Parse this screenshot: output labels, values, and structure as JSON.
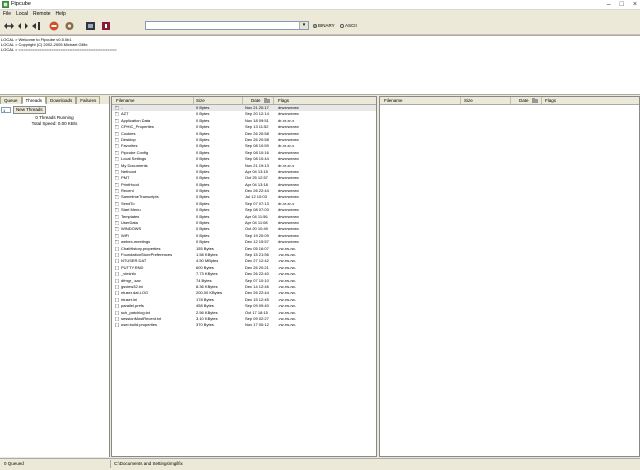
{
  "window": {
    "title": "Ftpcube"
  },
  "menu": [
    "File",
    "Local",
    "Remote",
    "Help"
  ],
  "toolbar": {
    "transfer_mode": {
      "binary": "BINARY",
      "ascii": "ASCII",
      "selected": "binary"
    },
    "icons": [
      "connect-icon",
      "disconnect-icon",
      "abort-icon",
      "stop-icon",
      "options-icon",
      "bookmarks-icon"
    ]
  },
  "log": [
    "LOCAL > Welcome to Ftpcube v0.5.0b1",
    "LOCAL > Copyright (C) 2002-2005 Michael Gilfix",
    "LOCAL > =========================================="
  ],
  "left_panel": {
    "tabs": [
      "Queue",
      "Threads",
      "Downloads",
      "Failures"
    ],
    "active_tab": "Threads",
    "thread_count": "1",
    "new_threads_label": "New Threads",
    "threads_running": "0 Threads Running",
    "total_speed": "Total Speed: 0.00 KB/s"
  },
  "local_pane": {
    "columns": {
      "filename": "Filename",
      "size": "Size",
      "date": "Date",
      "flags": "Flags"
    },
    "files": [
      {
        "name": "..",
        "size": "0 Bytes",
        "date": "Nov 21 20:17",
        "flags": "drwxrwxrwx",
        "type": "folder"
      },
      {
        "name": "AZT",
        "size": "0 Bytes",
        "date": "Sep 20 12:14",
        "flags": "drwxrwxrwx",
        "type": "folder"
      },
      {
        "name": "Application Data",
        "size": "0 Bytes",
        "date": "Nov 18 09:51",
        "flags": "dr-xr-xr-x",
        "type": "folder"
      },
      {
        "name": "CPHIC_Properties",
        "size": "0 Bytes",
        "date": "Sep 13 11:52",
        "flags": "drwxrwxrwx",
        "type": "folder"
      },
      {
        "name": "Cookies",
        "size": "0 Bytes",
        "date": "Dec 26 20:58",
        "flags": "drwxrwxrwx",
        "type": "folder"
      },
      {
        "name": "Desktop",
        "size": "0 Bytes",
        "date": "Dec 26 20:58",
        "flags": "drwxrwxrwx",
        "type": "folder"
      },
      {
        "name": "Favorites",
        "size": "0 Bytes",
        "date": "Sep 08 10:59",
        "flags": "dr-xr-xr-x",
        "type": "folder"
      },
      {
        "name": "Ftpcube Config",
        "size": "0 Bytes",
        "date": "Sep 08 10:16",
        "flags": "drwxrwxrwx",
        "type": "folder"
      },
      {
        "name": "Local Settings",
        "size": "0 Bytes",
        "date": "Sep 08 10:44",
        "flags": "drwxrwxrwx",
        "type": "folder"
      },
      {
        "name": "My Documents",
        "size": "0 Bytes",
        "date": "Nov 21 19:13",
        "flags": "dr-xr-xr-x",
        "type": "folder"
      },
      {
        "name": "Nethood",
        "size": "0 Bytes",
        "date": "Apr 04 13:15",
        "flags": "drwxrwxrwx",
        "type": "folder"
      },
      {
        "name": "PMT",
        "size": "0 Bytes",
        "date": "Oct 25 12:57",
        "flags": "drwxrwxrwx",
        "type": "folder"
      },
      {
        "name": "PrintHood",
        "size": "0 Bytes",
        "date": "Apr 04 13:18",
        "flags": "drwxrwxrwx",
        "type": "folder"
      },
      {
        "name": "Recent",
        "size": "0 Bytes",
        "date": "Dec 26 22:44",
        "flags": "drwxrwxrwx",
        "type": "folder"
      },
      {
        "name": "SametimeTranscripts",
        "size": "0 Bytes",
        "date": "Jul 12 10:03",
        "flags": "drwxrwxrwx",
        "type": "folder"
      },
      {
        "name": "SendTo",
        "size": "0 Bytes",
        "date": "Sep 07 07:13",
        "flags": "dr-xr-xr-x",
        "type": "folder"
      },
      {
        "name": "Start Menu",
        "size": "0 Bytes",
        "date": "Sep 08 07:03",
        "flags": "drwxrwxrwx",
        "type": "folder"
      },
      {
        "name": "Templates",
        "size": "0 Bytes",
        "date": "Apr 04 11:56",
        "flags": "drwxrwxrwx",
        "type": "folder"
      },
      {
        "name": "UserData",
        "size": "0 Bytes",
        "date": "Apr 04 11:08",
        "flags": "drwxrwxrwx",
        "type": "folder"
      },
      {
        "name": "WINDOWS",
        "size": "0 Bytes",
        "date": "Oct 20 10:49",
        "flags": "drwxrwxrwx",
        "type": "folder"
      },
      {
        "name": "WiFi",
        "size": "0 Bytes",
        "date": "Sep 19 20:09",
        "flags": "drwxrwxrwx",
        "type": "folder"
      },
      {
        "name": "webex-meetings",
        "size": "0 Bytes",
        "date": "Dec 12 15:57",
        "flags": "drwxrwxrwx",
        "type": "folder"
      },
      {
        "name": "ChatHistory.properties",
        "size": "155 Bytes",
        "date": "Dec 05 16:07",
        "flags": "-rw-rw-rw-",
        "type": "file"
      },
      {
        "name": "FoundationStorePreferences",
        "size": "1.58 KBytes",
        "date": "Sep 15 21:56",
        "flags": "-rw-rw-rw-",
        "type": "file"
      },
      {
        "name": "NTUSER.DAT",
        "size": "4.50 MBytes",
        "date": "Dec 27 12:42",
        "flags": "-rw-rw-rw-",
        "type": "file"
      },
      {
        "name": "PUTTY.RND",
        "size": "600 Bytes",
        "date": "Dec 26 20:21",
        "flags": "-rw-rw-rw-",
        "type": "file"
      },
      {
        "name": "_viminfo",
        "size": "7.73 KBytes",
        "date": "Dec 26 22:40",
        "flags": "-rw-rw-rw-",
        "type": "file"
      },
      {
        "name": "dfmgr_.sav",
        "size": "74 Bytes",
        "date": "Sep 07 10:10",
        "flags": "-rw-rw-rw-",
        "type": "file"
      },
      {
        "name": "gsview32.ini",
        "size": "8.36 KBytes",
        "date": "Dec 14 12:46",
        "flags": "-rw-rw-rw-",
        "type": "file"
      },
      {
        "name": "ntuser.dat.LOG",
        "size": "200.00 KBytes",
        "date": "Dec 26 22:44",
        "flags": "-rw-rw-rw-",
        "type": "file"
      },
      {
        "name": "ntuser.ini",
        "size": "178 Bytes",
        "date": "Dec 15 12:45",
        "flags": "-rw-rw-rw-",
        "type": "file"
      },
      {
        "name": "parallel.prefs",
        "size": "458 Bytes",
        "date": "Sep 09 09:40",
        "flags": "-rw-rw-rw-",
        "type": "file"
      },
      {
        "name": "sch_patchlog.txt",
        "size": "2.56 KBytes",
        "date": "Oct 17 18:15",
        "flags": "-rw-rw-rw-",
        "type": "file"
      },
      {
        "name": "sessionMostRecent.txt",
        "size": "3.10 KBytes",
        "date": "Sep 09 02:27",
        "flags": "-rw-rw-rw-",
        "type": "file"
      },
      {
        "name": "user.build.properties",
        "size": "370 Bytes",
        "date": "Nov 17 00:12",
        "flags": "-rw-rw-rw-",
        "type": "file"
      }
    ]
  },
  "remote_pane": {
    "columns": {
      "filename": "Filename",
      "size": "Size",
      "date": "Date",
      "flags": "Flags"
    }
  },
  "status": {
    "queue": "0 Queued",
    "path": "C:\\Documents and Settings\\mgilfix"
  }
}
